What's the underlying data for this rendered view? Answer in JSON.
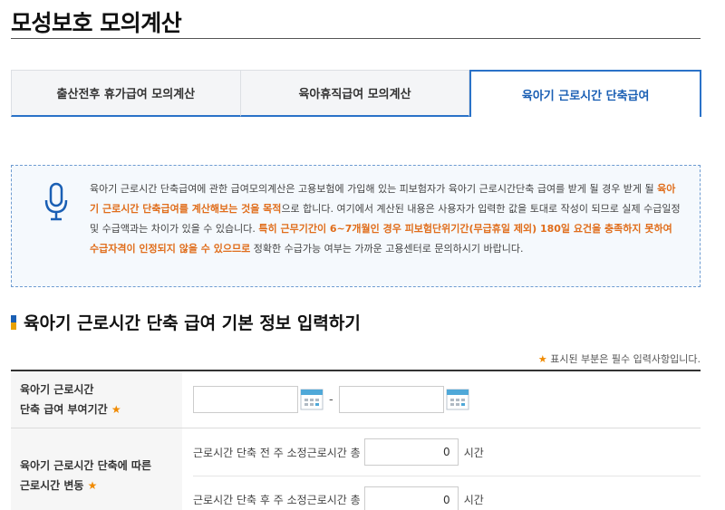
{
  "page": {
    "title": "모성보호 모의계산"
  },
  "tabs": [
    {
      "label": "출산전후 휴가급여 모의계산",
      "active": false
    },
    {
      "label": "육아휴직급여 모의계산",
      "active": false
    },
    {
      "label": "육아기 근로시간 단축급여",
      "active": true
    }
  ],
  "notice": {
    "icon": "microphone-icon",
    "text_1": "육아기 근로시간 단축급여에 관한 급여모의계산은 고용보험에 가입해 있는 피보험자가 육아기 근로시간단축 급여를 받게 될 경우 받게 될 ",
    "highlight_1": "육아기 근로시간 단축급여를 계산해보는 것을 목적",
    "text_2": "으로 합니다. 여기에서 계산된 내용은 사용자가 입력한 값을 토대로 작성이 되므로 실제 수급일정 및 수급액과는 차이가 있을 수 있습니다. ",
    "highlight_2": "특히 근무기간이 6~7개월인 경우 피보험단위기간(무급휴일 제외) 180일 요건을 충족하지 못하여 수급자격이 인정되지 않을 수 있으므로",
    "text_3": " 정확한 수급가능 여부는 가까운 고용센터로 문의하시기 바랍니다."
  },
  "section": {
    "title": "육아기 근로시간 단축 급여 기본 정보 입력하기"
  },
  "required_note": {
    "star": "★",
    "text": " 표시된 부분은 필수 입력사항입니다."
  },
  "form": {
    "period": {
      "label_line1": "육아기 근로시간",
      "label_line2": "단축 급여 부여기간",
      "star": "★",
      "start_value": "",
      "end_value": "",
      "separator": "-"
    },
    "hours": {
      "label_line1": "육아기 근로시간 단축에 따른",
      "label_line2": "근로시간 변동",
      "star": "★",
      "before_label": "근로시간 단축 전 주 소정근로시간 총",
      "before_value": "0",
      "after_label": "근로시간 단축 후 주 소정근로시간 총",
      "after_value": "0",
      "unit": "시간"
    }
  },
  "colors": {
    "accent": "#2a72c8",
    "highlight": "#e06d1b",
    "required": "#f08a00"
  }
}
